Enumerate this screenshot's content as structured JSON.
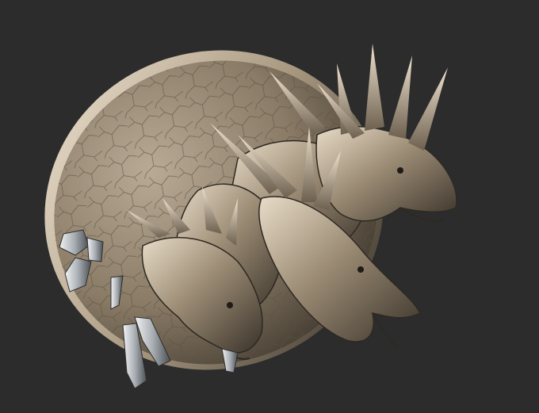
{
  "viewport": {
    "background_color": "#2c2c2c",
    "subject": "three-headed-dragon-relief-sculpture",
    "material_colors": {
      "highlight": "#e9ddcb",
      "mid": "#9a8a74",
      "shadow": "#3a342c",
      "crystal": "#cfd3d6"
    }
  }
}
